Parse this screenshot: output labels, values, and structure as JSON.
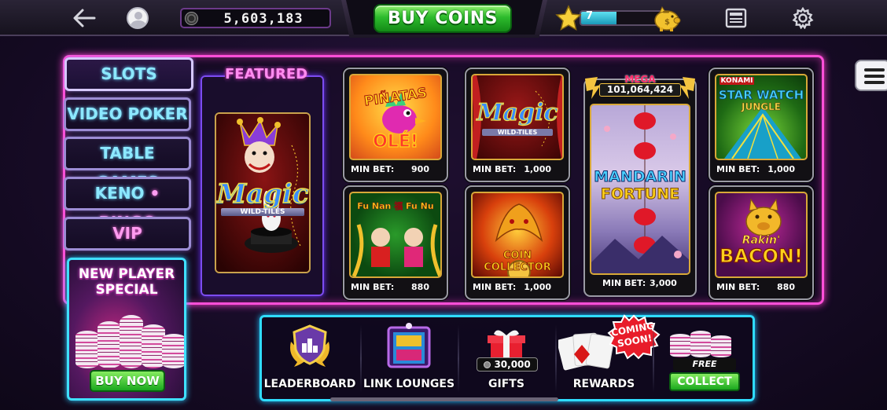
{
  "header": {
    "coin_balance": "5,603,183",
    "buy_coins_label": "BUY COINS",
    "level": "7",
    "level_progress": 0.42
  },
  "categories": [
    {
      "label": "SLOTS",
      "active": true
    },
    {
      "label": "VIDEO POKER",
      "active": false
    },
    {
      "label": "TABLE GAMES",
      "active": false
    },
    {
      "label": "KENO",
      "sep": "•",
      "label2": "BINGO",
      "active": false
    },
    {
      "label": "VIP",
      "active": false
    }
  ],
  "promo": {
    "title_line1": "NEW PLAYER",
    "title_line2": "SPECIAL",
    "button": "BUY NOW"
  },
  "featured": {
    "label": "FEATURED",
    "game_title": "Magic",
    "game_subtitle": "WILD-TILES"
  },
  "min_bet_label": "MIN BET:",
  "games": [
    {
      "title_line1": "PIÑATAS",
      "title_line2": "OLÉ!",
      "min_bet": "900"
    },
    {
      "title_line1": "Magic",
      "title_line2": "WILD-TILES",
      "min_bet": "1,000"
    },
    {
      "brand": "KONAMI",
      "title_line1": "STAR WATCH",
      "title_line2": "JUNGLE",
      "min_bet": "1,000"
    },
    {
      "title_line1": "Fu Nan 福 Fu Nu",
      "title_line2": "",
      "min_bet": "880"
    },
    {
      "title_line1": "COIN COLLECTOR",
      "title_line2": "",
      "min_bet": "1,000"
    },
    {
      "title_line1": "Rakin'",
      "title_line2": "BACON!",
      "min_bet": "880"
    }
  ],
  "mega_game": {
    "mega_label": "MEGA",
    "jackpot": "101,064,424",
    "title_line1": "MANDARIN",
    "title_line2": "FORTUNE",
    "min_bet": "3,000"
  },
  "bottom_bar": {
    "leaderboard": "LEADERBOARD",
    "link_lounges": "LINK LOUNGES",
    "gifts": "GIFTS",
    "gifts_amount": "30,000",
    "rewards": "REWARDS",
    "coming_soon_line1": "COMING",
    "coming_soon_line2": "SOON!",
    "free_bonus": "FREE BONUS!",
    "collect": "COLLECT"
  },
  "colors": {
    "panel_border": "#ff4fd8",
    "bottom_border": "#2fdcff",
    "button_green": "#2dbb2d",
    "tab_text": "#8ce8ff"
  }
}
